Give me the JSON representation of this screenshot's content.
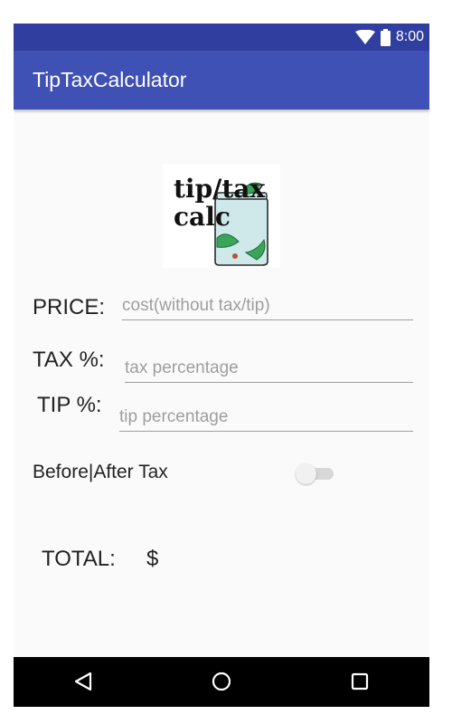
{
  "status_bar": {
    "time": "8:00",
    "icons": [
      "wifi-icon",
      "battery-icon"
    ]
  },
  "app_bar": {
    "title": "TipTaxCalculator"
  },
  "logo": {
    "text_line1": "tip/tax",
    "text_line2": "calc"
  },
  "form": {
    "price": {
      "label": "PRICE:",
      "placeholder": "cost(without tax/tip)",
      "value": ""
    },
    "tax": {
      "label": "TAX %:",
      "placeholder": "tax percentage",
      "value": ""
    },
    "tip": {
      "label": "TIP %:",
      "placeholder": "tip percentage",
      "value": ""
    },
    "toggle": {
      "label": "Before|After Tax",
      "checked": false
    }
  },
  "total": {
    "label": "TOTAL:",
    "currency": "$",
    "value": ""
  },
  "nav_bar": {
    "icons": [
      "back-icon",
      "home-icon",
      "recents-icon"
    ]
  },
  "colors": {
    "status_bar": "#303f9f",
    "app_bar": "#3f51b5",
    "background": "#fafafa",
    "nav_bar": "#000000"
  }
}
